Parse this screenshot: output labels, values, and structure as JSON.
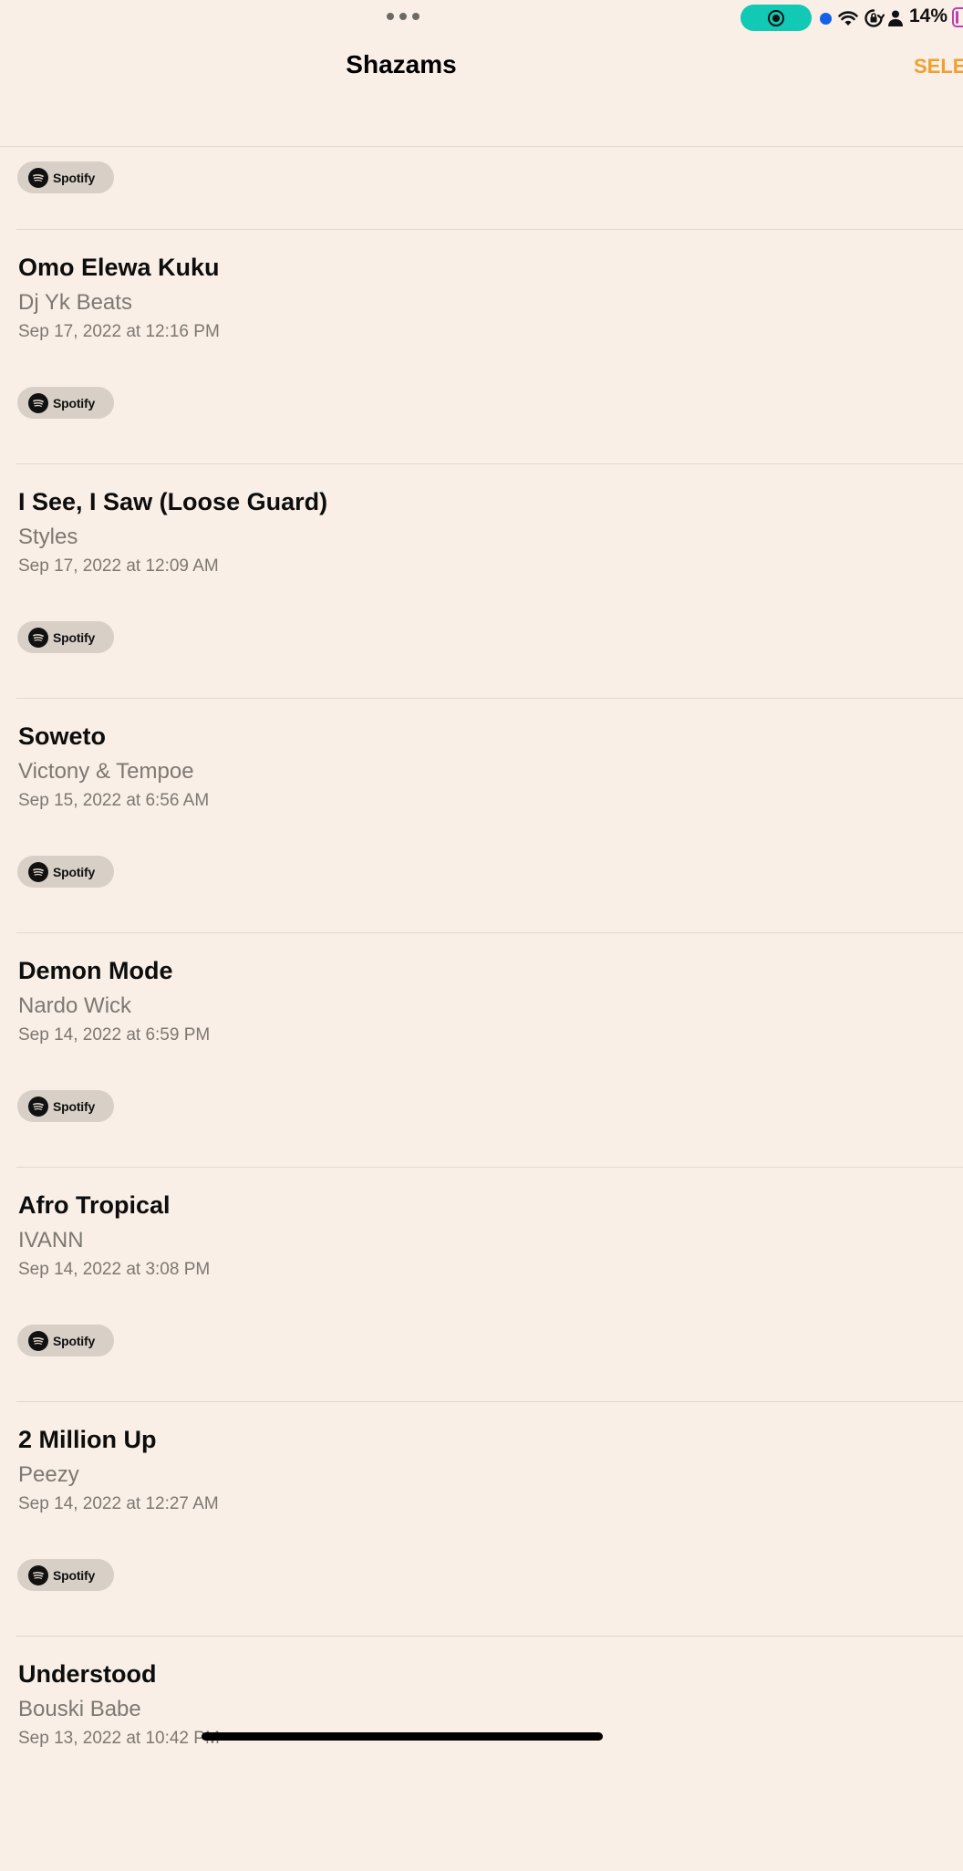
{
  "status_bar": {
    "battery_percent": "14%",
    "colors": {
      "record_pill": "#12c9b5",
      "location_dot": "#1460e8",
      "battery_outline": "#c13fb0"
    },
    "icons": [
      "more-dots-icon",
      "screen-record-icon",
      "location-dot-icon",
      "wifi-icon",
      "orientation-lock-icon",
      "person-icon",
      "battery-icon"
    ]
  },
  "header": {
    "title": "Shazams",
    "select_label": "SELE",
    "accent_color": "#f0a030"
  },
  "spotify_label": "Spotify",
  "songs": [
    {
      "title": "Omo Elewa Kuku",
      "artist": "Dj Yk Beats",
      "date": "Sep 17, 2022 at 12:16 PM"
    },
    {
      "title": "I See, I Saw (Loose Guard)",
      "artist": "Styles",
      "date": "Sep 17, 2022 at 12:09 AM"
    },
    {
      "title": "Soweto",
      "artist": "Victony & Tempoe",
      "date": "Sep 15, 2022 at 6:56 AM"
    },
    {
      "title": "Demon Mode",
      "artist": "Nardo Wick",
      "date": "Sep 14, 2022 at 6:59 PM"
    },
    {
      "title": "Afro Tropical",
      "artist": "IVANN",
      "date": "Sep 14, 2022 at 3:08 PM"
    },
    {
      "title": "2 Million Up",
      "artist": "Peezy",
      "date": "Sep 14, 2022 at 12:27 AM"
    },
    {
      "title": "Understood",
      "artist": "Bouski Babe",
      "date": "Sep 13, 2022 at 10:42 PM"
    }
  ]
}
